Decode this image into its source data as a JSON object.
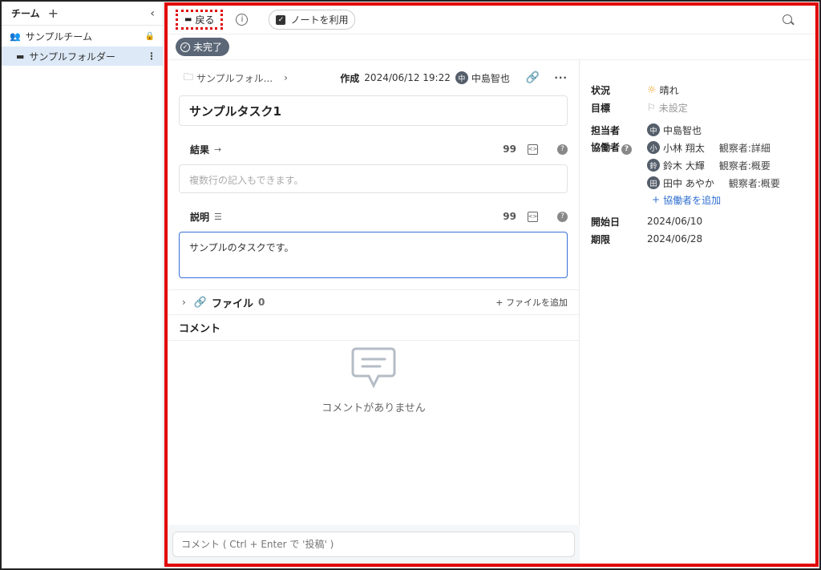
{
  "sidebar": {
    "title": "チーム",
    "team_name": "サンプルチーム",
    "folder_name": "サンプルフォルダー"
  },
  "toolbar": {
    "back_label": "戻る",
    "note_label": "ノートを利用"
  },
  "status": {
    "label": "未完了"
  },
  "task": {
    "breadcrumb": "サンプルフォル...",
    "created_label": "作成",
    "created_date": "2024/06/12 19:22",
    "creator_initial": "中",
    "creator_name": "中島智也",
    "title": "サンプルタスク1",
    "result_label": "結果",
    "result_placeholder": "複数行の記入もできます。",
    "desc_label": "説明",
    "desc_value": "サンプルのタスクです。",
    "quote_icon_glyph": "99",
    "help_glyph": "?"
  },
  "files": {
    "label": "ファイル",
    "count": "0",
    "add_label": "ファイルを追加"
  },
  "comments": {
    "label": "コメント",
    "empty_text": "コメントがありません",
    "input_placeholder": "コメント ( Ctrl + Enter で '投稿' )"
  },
  "details": {
    "status_label": "状況",
    "status_value": "晴れ",
    "goal_label": "目標",
    "goal_value": "未設定",
    "assignee_label": "担当者",
    "assignee_initial": "中",
    "assignee_name": "中島智也",
    "collab_label": "協働者",
    "collaborators": [
      {
        "initial": "小",
        "name": "小林 翔太",
        "role": "観察者:詳細"
      },
      {
        "initial": "鈴",
        "name": "鈴木 大輝",
        "role": "観察者:概要"
      },
      {
        "initial": "田",
        "name": "田中 あやか",
        "role": "観察者:概要"
      }
    ],
    "add_collab_label": "協働者を追加",
    "start_label": "開始日",
    "start_value": "2024/06/10",
    "due_label": "期限",
    "due_value": "2024/06/28"
  },
  "colors": {
    "accent_red": "#e00000",
    "link_blue": "#2f6fd0",
    "status_pill": "#5b6777",
    "selected_folder_bg": "#dde9f7"
  }
}
